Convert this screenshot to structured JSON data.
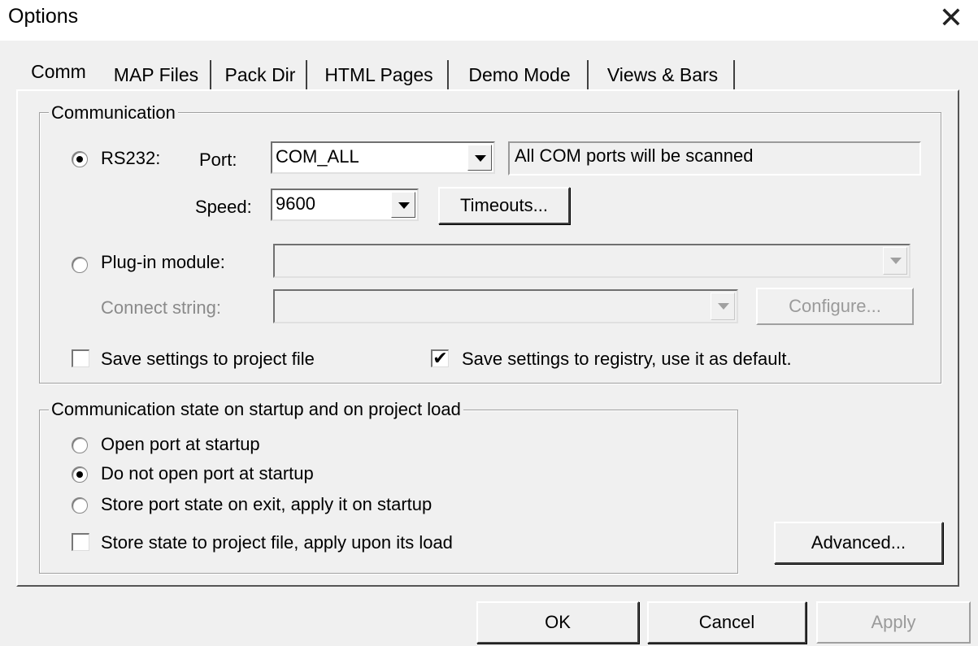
{
  "window": {
    "title": "Options",
    "close_glyph": "✕"
  },
  "tabs": [
    {
      "label": "Comm",
      "active": true
    },
    {
      "label": "MAP Files",
      "active": false
    },
    {
      "label": "Pack Dir",
      "active": false
    },
    {
      "label": "HTML Pages",
      "active": false
    },
    {
      "label": "Demo Mode",
      "active": false
    },
    {
      "label": "Views & Bars",
      "active": false
    }
  ],
  "communication": {
    "legend": "Communication",
    "rs232": {
      "label": "RS232:",
      "selected": true,
      "port_label": "Port:",
      "port_value": "COM_ALL",
      "port_info": "All COM ports will be scanned",
      "speed_label": "Speed:",
      "speed_value": "9600",
      "timeouts_button": "Timeouts..."
    },
    "plugin": {
      "label": "Plug-in module:",
      "selected": false,
      "module_value": "",
      "connect_string_label": "Connect string:",
      "connect_string_value": "",
      "configure_button": "Configure..."
    },
    "save_project": {
      "label": "Save settings to project file",
      "checked": false
    },
    "save_registry": {
      "label": "Save settings to registry, use it as default.",
      "checked": true
    }
  },
  "startup": {
    "legend": "Communication state on startup and on project load",
    "options": [
      {
        "label": "Open port at startup",
        "selected": false
      },
      {
        "label": "Do not open port at startup",
        "selected": true
      },
      {
        "label": "Store port state on exit, apply it on startup",
        "selected": false
      }
    ],
    "store_state": {
      "label": "Store state to project file, apply upon its load",
      "checked": false
    }
  },
  "buttons": {
    "advanced": "Advanced...",
    "ok": "OK",
    "cancel": "Cancel",
    "apply": "Apply"
  },
  "check_glyph": "✔"
}
